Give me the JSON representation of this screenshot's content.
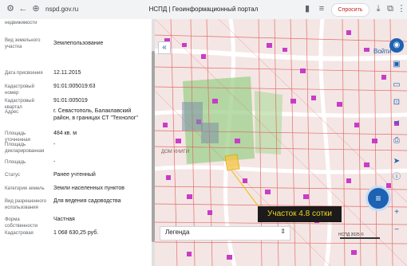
{
  "browser": {
    "url": "nspd.gov.ru",
    "title": "НСПД | Геоинформационный портал",
    "ask_label": "Спросить"
  },
  "panel": {
    "partial_top_label": "недвижимости",
    "rows": [
      {
        "label": "Вид земельного участка",
        "value": "Землепользование"
      },
      {
        "label": "Дата присвоения",
        "value": "12.11.2015"
      },
      {
        "label": "Кадастровый номер",
        "value": "91:01:005019:63"
      },
      {
        "label": "Кадастровый квартал",
        "value": "91:01:005019"
      },
      {
        "label": "Адрес",
        "value": "г. Севастополь, Балаклавский район, в границах СТ \"Технолог\""
      },
      {
        "label": "Площадь уточненная",
        "value": "484 кв. м"
      },
      {
        "label": "Площадь декларированная",
        "value": "-"
      },
      {
        "label": "Площадь",
        "value": "-"
      },
      {
        "label": "Статус",
        "value": "Ранее учтенный"
      },
      {
        "label": "Категория земель",
        "value": "Земли населенных пунктов"
      },
      {
        "label": "Вид разрешенного использования",
        "value": "Для ведения садоводства"
      },
      {
        "label": "Форма собственности",
        "value": "Частная"
      },
      {
        "label": "Кадастровая",
        "value": "1 068 630,25 руб."
      }
    ]
  },
  "map": {
    "login_label": "Войти",
    "legend_label": "Легенда",
    "caption": "Участок 4.8 сотки",
    "map_text": "ДОМ КНИГИ",
    "scale_text": "НСПД 2025 ©"
  },
  "colors": {
    "map_bg": "#f4e6e4",
    "parcel_border": "#e05a5a",
    "building": "#c83cc8",
    "green_area": "#9fd08c",
    "accent": "#1d62b3",
    "caption_bg": "#1b1b1b",
    "caption_text": "#f1d21e"
  }
}
